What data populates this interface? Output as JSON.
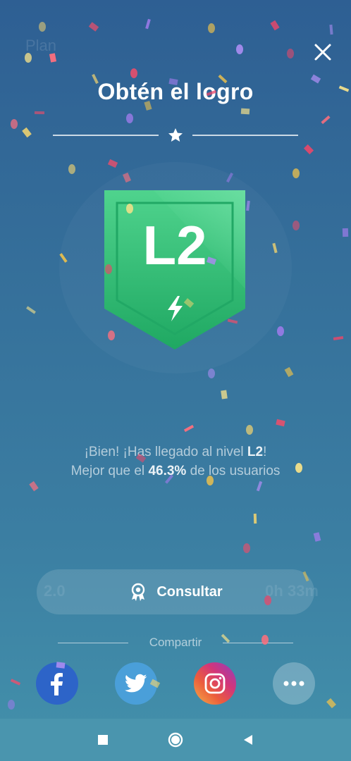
{
  "background_screen": {
    "title": "Plan",
    "stat_left": "2.0",
    "stat_right": "0h 33m"
  },
  "modal": {
    "title": "Obtén el logro",
    "badge": {
      "level": "L2",
      "color": "#2fb96f",
      "icon": "lightning-icon"
    },
    "message": {
      "line1_prefix": "¡Bien! ¡Has llegado al nivel ",
      "level": "L2",
      "line1_suffix": "!",
      "line2_prefix": "Mejor que el ",
      "percent": "46.3%",
      "line2_suffix": " de los usuarios"
    },
    "consult_button": {
      "label": "Consultar",
      "icon": "award-icon"
    },
    "share": {
      "label": "Compartir",
      "buttons": [
        {
          "name": "facebook",
          "icon": "facebook-icon",
          "color": "#2d64c8"
        },
        {
          "name": "twitter",
          "icon": "twitter-icon",
          "color": "#4a9fd9"
        },
        {
          "name": "instagram",
          "icon": "instagram-icon",
          "color": "#d2357a"
        },
        {
          "name": "more",
          "icon": "more-icon",
          "color": "#ffffff"
        }
      ]
    }
  },
  "nav": {
    "buttons": [
      {
        "name": "recents",
        "icon": "square-icon"
      },
      {
        "name": "home",
        "icon": "circle-icon"
      },
      {
        "name": "back",
        "icon": "triangle-back-icon"
      }
    ]
  }
}
